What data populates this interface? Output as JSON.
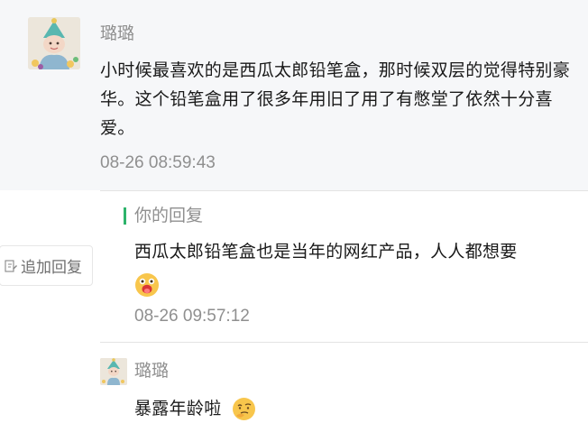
{
  "comment": {
    "author": "璐璐",
    "text": "小时候最喜欢的是西瓜太郎铅笔盒，那时候双层的觉得特别豪华。这个铅笔盒用了很多年用旧了用了有憋堂了依然十分喜爱。",
    "time": "08-26 08:59:43"
  },
  "reply": {
    "label": "你的回复",
    "text": "西瓜太郎铅笔盒也是当年的网红产品，人人都想要",
    "emoji": "surprised-tongue-emoji",
    "time": "08-26 09:57:12"
  },
  "add_reply": {
    "label": "追加回复",
    "icon": "edit-icon"
  },
  "followup": {
    "author": "璐璐",
    "text": "暴露年龄啦",
    "emoji": "thinking-emoji"
  },
  "colors": {
    "accent": "#2db36b",
    "muted_text": "#8f8f8f",
    "background_top": "#f6f7f9"
  }
}
